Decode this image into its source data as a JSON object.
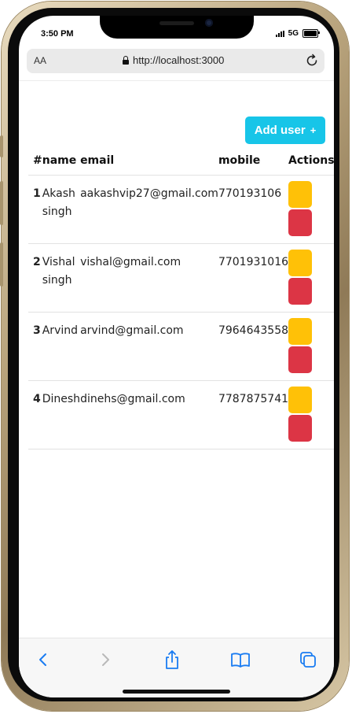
{
  "status_bar": {
    "time": "3:50 PM",
    "network": "5G"
  },
  "browser": {
    "text_size_label": "AA",
    "url": "http://localhost:3000"
  },
  "page": {
    "add_button_label": "Add user",
    "add_button_icon": "+",
    "table": {
      "columns": [
        "#",
        "name",
        "email",
        "mobile",
        "Actions"
      ],
      "rows": [
        {
          "num": "1",
          "name": "Akash singh",
          "email": "aakashvip27@gmail.com",
          "mobile": "770193106"
        },
        {
          "num": "2",
          "name": "Vishal singh",
          "email": "vishal@gmail.com",
          "mobile": "7701931016"
        },
        {
          "num": "3",
          "name": "Arvind",
          "email": "arvind@gmail.com",
          "mobile": "7964643558"
        },
        {
          "num": "4",
          "name": "Dinesh",
          "email": "dinehs@gmail.com",
          "mobile": "7787875741"
        }
      ]
    }
  },
  "colors": {
    "add_button": "#17c5e8",
    "edit_button": "#ffc107",
    "delete_button": "#dc3545",
    "browser_accent": "#1a7cf2"
  },
  "toolbar_icons": [
    "back-icon",
    "forward-icon",
    "share-icon",
    "bookmarks-icon",
    "tabs-icon"
  ]
}
